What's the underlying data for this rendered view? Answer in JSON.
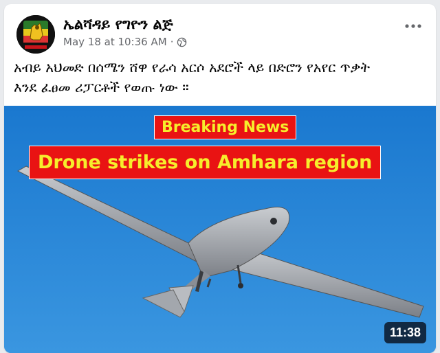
{
  "post": {
    "page_name": "ኤልሻዳይ የግዮን ልጅ",
    "timestamp": "May 18 at 10:36 AM",
    "separator": "·",
    "privacy_icon": "globe-icon",
    "more_icon": "more-options-icon",
    "caption_line1": "አብይ አህመድ በሰሜን ሸዋ የራሳ አርሶ አደሮች ላይ በድሮን  የአየር ጥቃት",
    "caption_line2": "እንደ ፈፀመ  ሪፓርቶች የወጡ ነው ።"
  },
  "video": {
    "badge": "Breaking News",
    "headline": "Drone strikes on Amhara region",
    "duration": "11:38",
    "colors": {
      "sky": "#1f7fd0",
      "banner_red": "#e91313",
      "banner_text": "#f6ee2c"
    }
  }
}
